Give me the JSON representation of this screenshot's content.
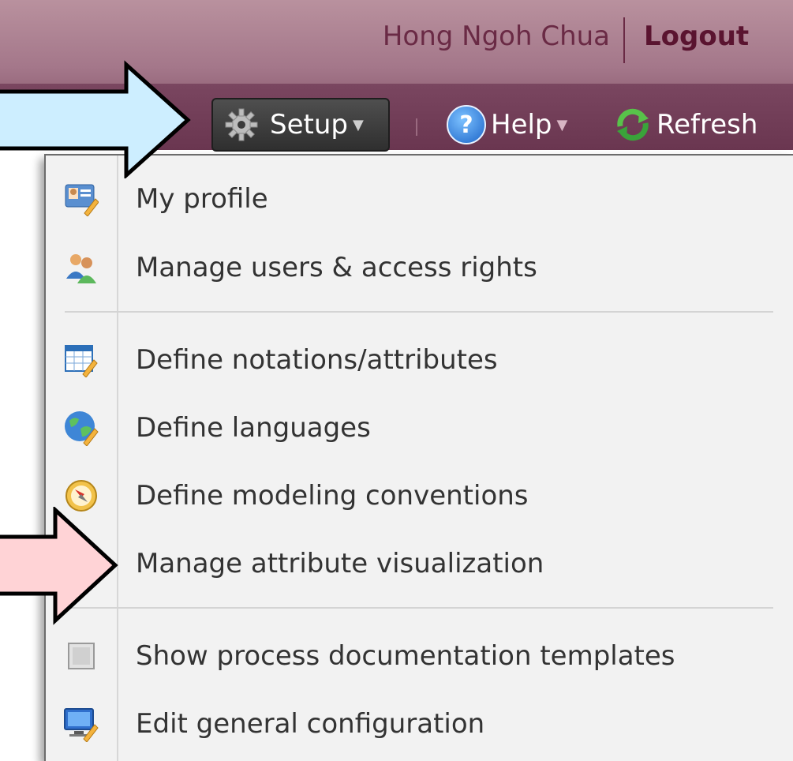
{
  "header": {
    "user_name": "Hong Ngoh Chua",
    "logout_label": "Logout"
  },
  "toolbar": {
    "setup_label": "Setup",
    "help_label": "Help",
    "refresh_label": "Refresh",
    "help_icon_text": "?"
  },
  "menu": {
    "items": [
      {
        "label": "My profile",
        "icon": "profile-card-icon"
      },
      {
        "label": "Manage users & access rights",
        "icon": "users-icon"
      },
      {
        "label": "Define notations/attributes",
        "icon": "table-edit-icon"
      },
      {
        "label": "Define languages",
        "icon": "globe-edit-icon"
      },
      {
        "label": "Define modeling conventions",
        "icon": "compass-icon"
      },
      {
        "label": "Manage attribute visualization",
        "icon": "attribute-visualization-icon"
      },
      {
        "label": "Show process documentation templates",
        "icon": "checkbox-icon"
      },
      {
        "label": "Edit general configuration",
        "icon": "monitor-edit-icon"
      }
    ]
  },
  "colors": {
    "header_top": "#b9919e",
    "header_bottom": "#6a3650",
    "arrow_blue": "#cdeeff",
    "arrow_pink": "#ffd3d6",
    "menu_bg": "#f2f2f2"
  }
}
